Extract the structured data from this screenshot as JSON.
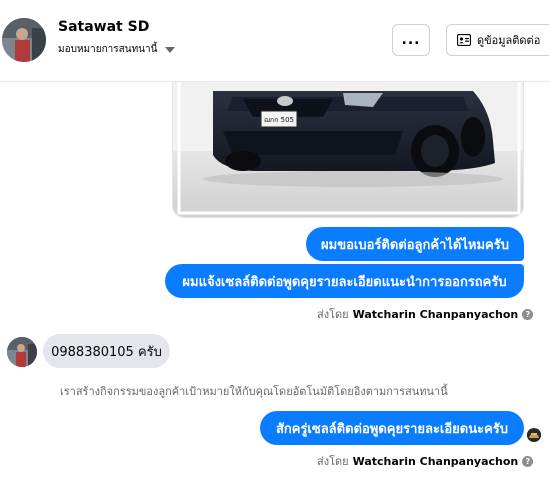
{
  "header": {
    "name": "Satawat SD",
    "subtitle": "มอบหมายการสนทนานี้",
    "more_label": "...",
    "info_label": "ดูข้อมูลติดต่อ"
  },
  "image_message": {
    "plate_text": "ฌกก 505"
  },
  "messages": {
    "out_1": "ผมขอเบอร์ติดต่อลูกค้าได้ไหมครับ",
    "out_2": "ผมแจ้งเซลล์ติดต่อพูดคุยรายละเอียดแนะนำการออกรถครับ",
    "in_1": "0988380105 ครับ",
    "system_note": "เราสร้างกิจกรรมของลูกค้าเป้าหมายให้กับคุณโดยอัตโนมัติโดยอิงตามการสนทนานี้",
    "out_3": "สักครู่เซลล์ติดต่อพูดคุยรายละเอียดนะครับ"
  },
  "sent_by": {
    "prefix": "ส่งโดย",
    "name": "Watcharin Chanpanyachon",
    "help_glyph": "?"
  },
  "colors": {
    "bubble_out": "#0a7cff",
    "bubble_in": "#e4e6eb",
    "muted_text": "#65676b"
  }
}
